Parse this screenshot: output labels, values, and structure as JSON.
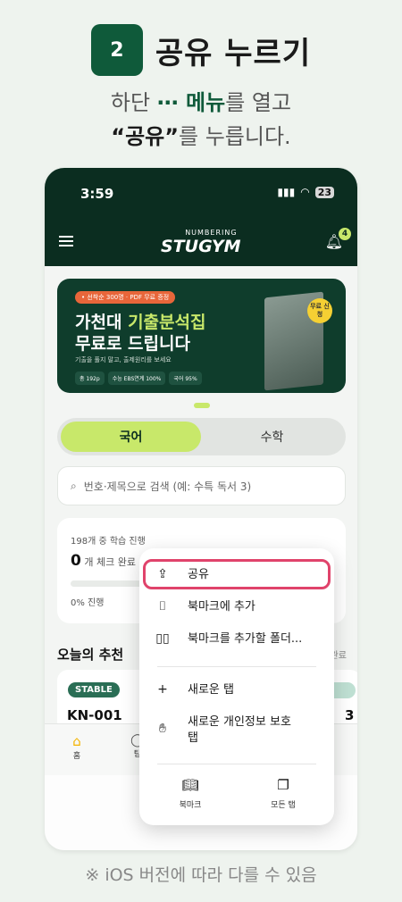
{
  "step": {
    "number": "2",
    "title": "공유 누르기",
    "instruction_pre": "하단 ",
    "instruction_dots": "⋯ 메뉴",
    "instruction_post": "를 열고",
    "instruction2_quote": "“공유”",
    "instruction2_post": "를 누릅니다."
  },
  "footnote": "※ iOS 버전에 따라 다를 수 있음",
  "status_bar": {
    "time": "3:59",
    "battery": "23"
  },
  "header": {
    "logo_sub": "NUMBERING",
    "logo_main": "STUGYM",
    "notification_count": "4"
  },
  "banner": {
    "tag": "• 선착순 300명 · PDF 무료 증정",
    "title1_prefix": "가천대 ",
    "title1_accent": "기출분석집",
    "title2": "무료로 드립니다",
    "desc": "기출을 풀지 말고, 출제원리를 보세요",
    "chips": [
      "총 192p",
      "수능 EBS연계 100%",
      "국어 95%"
    ],
    "badge": "무료 신청"
  },
  "tabs": {
    "korean": "국어",
    "math": "수학"
  },
  "search": {
    "placeholder": "번호·제목으로 검색 (예: 수특 독서 3)"
  },
  "progress": {
    "label": "198개 중 학습 진행",
    "count": "0",
    "count_suffix": " 개 체크 완료",
    "percent_text": "0% 진행",
    "fraction": 0
  },
  "recommend": {
    "title": "오늘의 추천",
    "more": "완료",
    "badge": "STABLE",
    "code": "KN-001",
    "right_number": "3"
  },
  "bottom_nav": {
    "home": "홈",
    "explore": "탐"
  },
  "menu": {
    "share": "공유",
    "add_bookmark": "북마크에 추가",
    "add_bookmark_folder": "북마크를 추가할 폴더...",
    "new_tab": "새로운 탭",
    "new_private_tab": "새로운 개인정보 보호 탭",
    "bookmarks": "북마크",
    "all_tabs": "모든 탭"
  },
  "colors": {
    "brand_dark": "#0b2d20",
    "accent_lime": "#c8e86a",
    "highlight": "#e0436b"
  }
}
